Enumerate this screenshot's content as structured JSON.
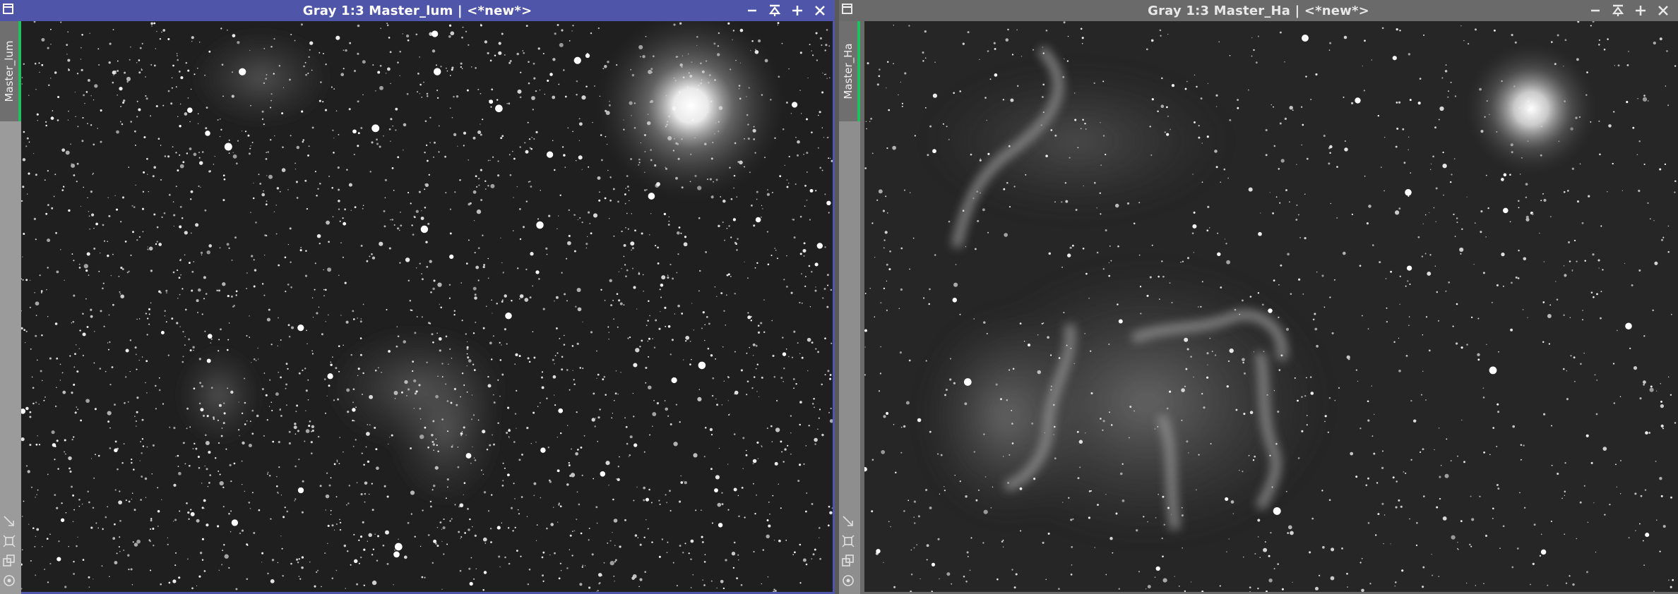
{
  "windows": [
    {
      "title": "Gray 1:3 Master_lum | <*new*>",
      "view_tab": "Master_lum",
      "active": true
    },
    {
      "title": "Gray 1:3 Master_Ha | <*new*>",
      "view_tab": "Master_Ha",
      "active": false
    }
  ],
  "colors": {
    "active_title": "#4f55a8",
    "inactive_title": "#6a6a6a",
    "tab_accent": "#20c060"
  },
  "icons": {
    "title_controls": [
      "minimize-icon",
      "shade-icon",
      "maximize-icon",
      "close-icon"
    ],
    "side_tools": [
      "zoom-icon",
      "fit-icon",
      "clone-icon",
      "target-icon"
    ]
  }
}
